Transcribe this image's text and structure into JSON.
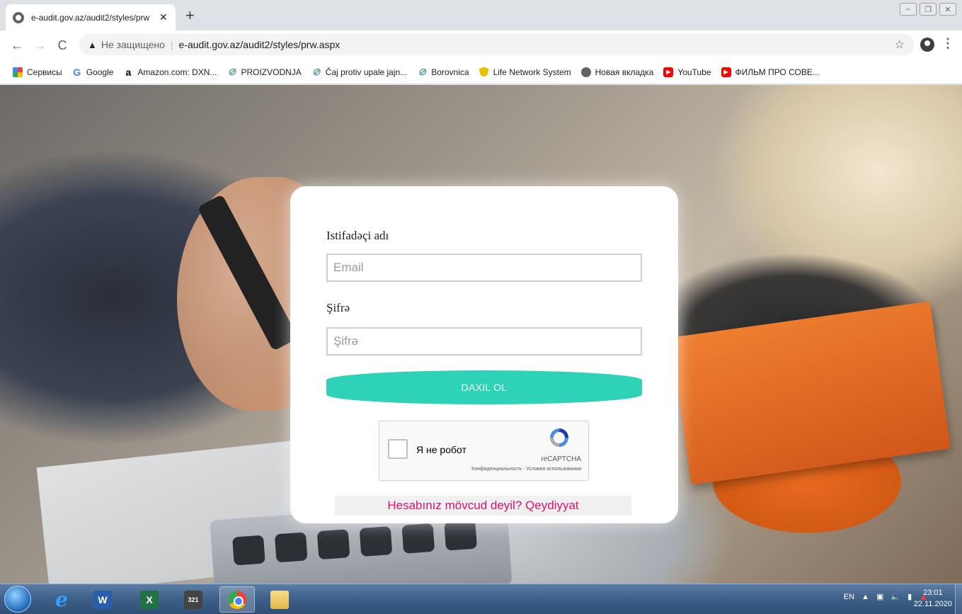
{
  "browser": {
    "tab_title": "e-audit.gov.az/audit2/styles/prw",
    "tab_close": "✕",
    "new_tab": "+",
    "security_label": "Не защищено",
    "url": "e-audit.gov.az/audit2/styles/prw.aspx",
    "bookmarks": [
      {
        "label": "Сервисы",
        "icon": "apps-grid-icon"
      },
      {
        "label": "Google",
        "icon": "google-icon"
      },
      {
        "label": "Amazon.com: DXN...",
        "icon": "amazon-icon"
      },
      {
        "label": "PROIZVODNJA",
        "icon": "leaf-icon"
      },
      {
        "label": "Čaj protiv upale jajn...",
        "icon": "leaf-icon"
      },
      {
        "label": "Borovnica",
        "icon": "leaf-icon"
      },
      {
        "label": "Life Network System",
        "icon": "shield-icon"
      },
      {
        "label": "Новая вкладка",
        "icon": "globe-icon"
      },
      {
        "label": "YouTube",
        "icon": "youtube-icon"
      },
      {
        "label": "ФИЛЬМ ПРО СОВЕ...",
        "icon": "youtube-icon"
      }
    ]
  },
  "login": {
    "username_label": "Istifadəçi adı",
    "email_placeholder": "Email",
    "password_label": "Şifrə",
    "password_placeholder": "Şifrə",
    "submit_label": "DAXIL OL",
    "register_link": "Hesabınız mövcud deyil? Qeydiyyat"
  },
  "recaptcha": {
    "checkbox_label": "Я не робот",
    "brand": "reCAPTCHA",
    "terms": "Конфиденциальность - Условия использования"
  },
  "taskbar": {
    "language": "EN",
    "time": "23:01",
    "date": "22.11.2020"
  },
  "colors": {
    "accent": "#2ed3b7",
    "link": "#e0116a"
  }
}
